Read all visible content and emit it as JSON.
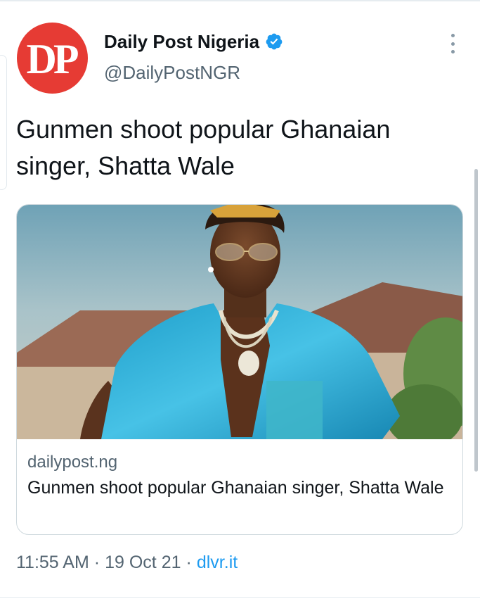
{
  "author": {
    "avatar_text": "DP",
    "display_name": "Daily Post Nigeria",
    "handle": "@DailyPostNGR",
    "verified": true,
    "avatar_color": "#e63b34",
    "verified_color": "#1d9bf0"
  },
  "more_icon": "more-vertical-icon",
  "tweet": {
    "text": "Gunmen shoot popular Ghanaian singer, Shatta Wale"
  },
  "card": {
    "image_icon": "article-photo",
    "domain": "dailypost.ng",
    "title": "Gunmen shoot popular Ghanaian singer, Shatta Wale"
  },
  "meta": {
    "time": "11:55 AM",
    "separator": "·",
    "date": "19 Oct 21",
    "source": "dlvr.it",
    "link_color": "#1d9bf0"
  }
}
